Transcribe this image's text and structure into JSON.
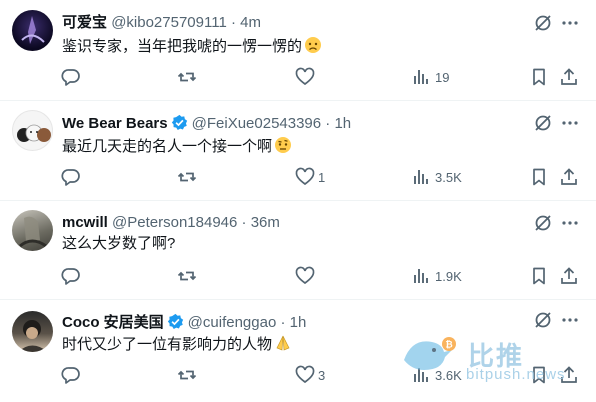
{
  "tweets": [
    {
      "name": "可爱宝",
      "handle": "@kibo275709111",
      "time": "4m",
      "verified": false,
      "text": "鉴识专家，当年把我唬的一愣一愣的",
      "emoji": "worried-face",
      "likes": "",
      "views": "19"
    },
    {
      "name": "We Bear Bears",
      "handle": "@FeiXue02543396",
      "time": "1h",
      "verified": true,
      "text": "最近几天走的名人一个接一个啊",
      "emoji": "face-with-raised-eyebrow",
      "likes": "1",
      "views": "3.5K"
    },
    {
      "name": "mcwill",
      "handle": "@Peterson184946",
      "time": "36m",
      "verified": false,
      "text": "这么大岁数了啊?",
      "emoji": "",
      "likes": "",
      "views": "1.9K"
    },
    {
      "name": "Coco 安居美国",
      "handle": "@cuifenggao",
      "time": "1h",
      "verified": true,
      "text": "时代又少了一位有影响力的人物",
      "emoji": "folded-hands",
      "likes": "3",
      "views": "3.6K"
    }
  ],
  "separator": "·",
  "watermark": {
    "cn": "比推",
    "url": "bitpush.news"
  },
  "colors": {
    "verified": "#1d9bf0",
    "icon": "#536471",
    "text": "#0f1419"
  }
}
